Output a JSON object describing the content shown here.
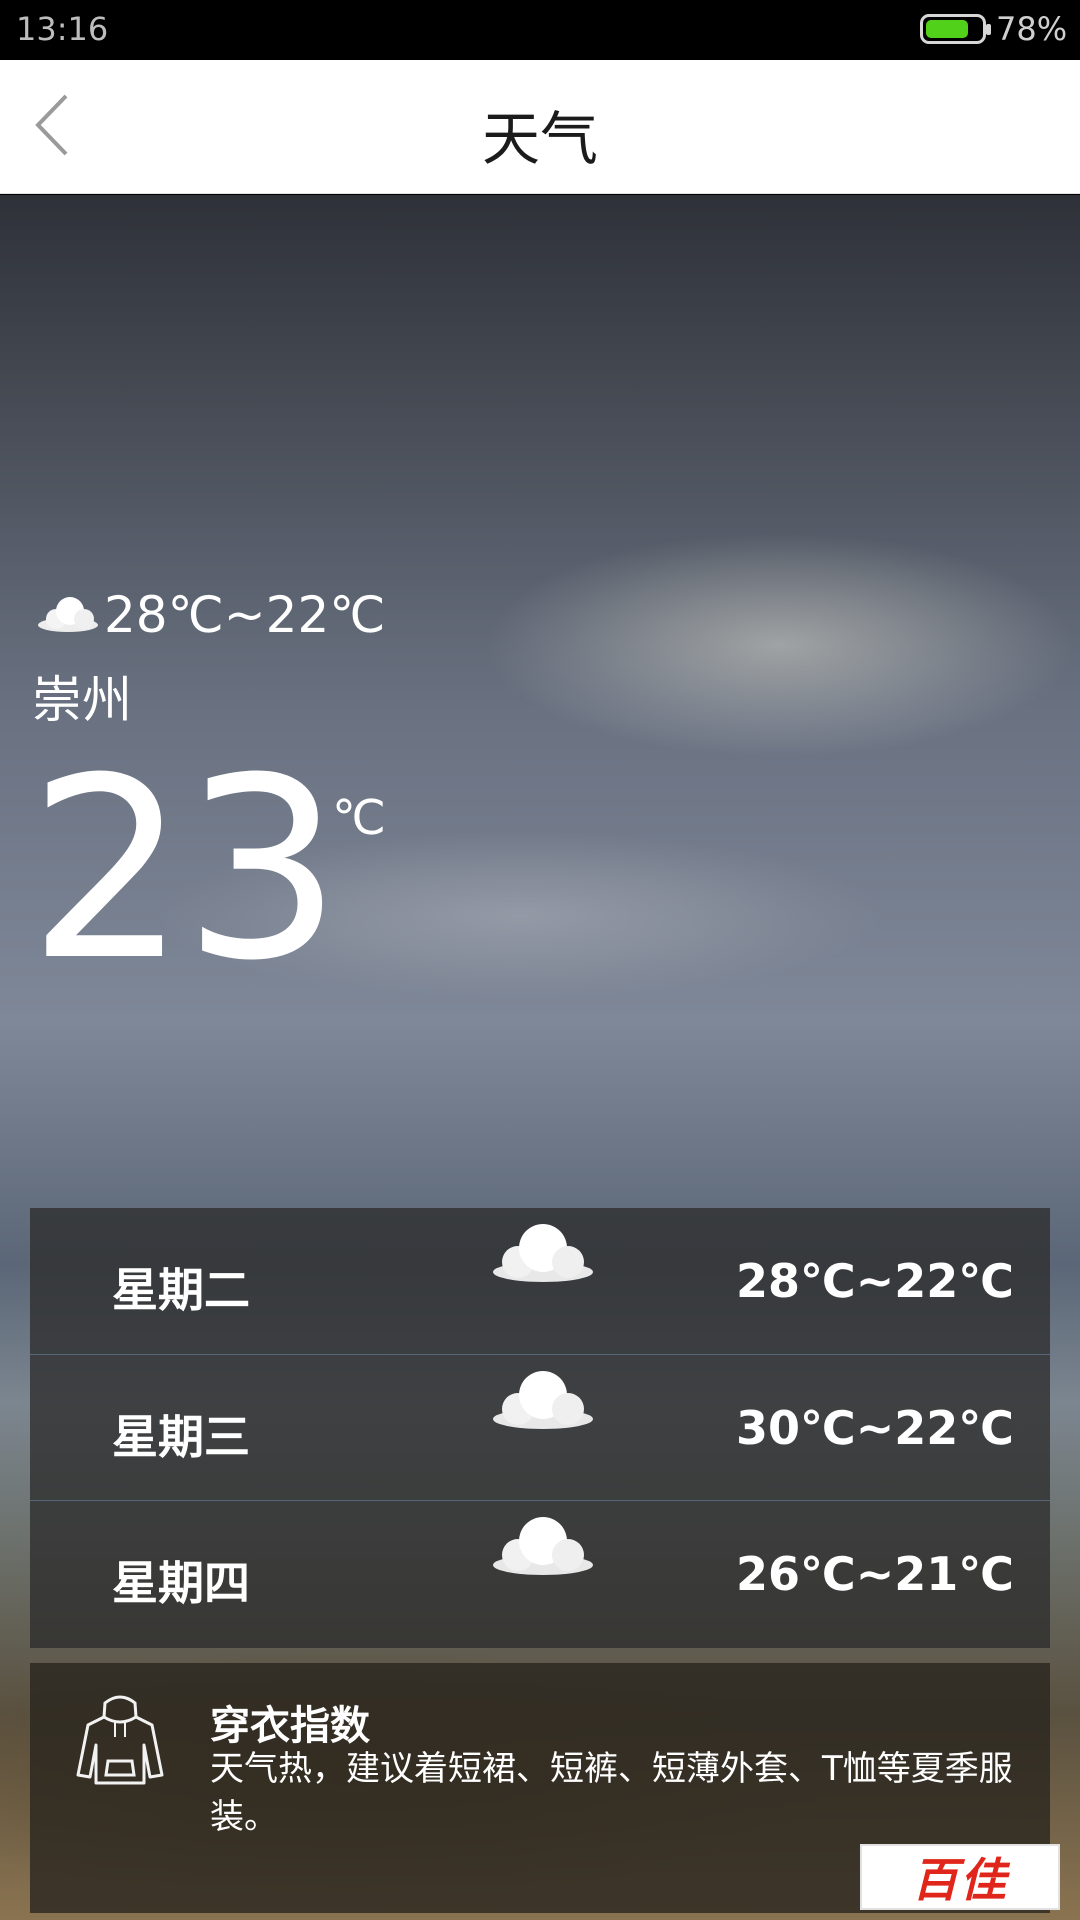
{
  "status_bar": {
    "time": "13:16",
    "battery_percent": "78%",
    "battery_level": 0.78
  },
  "header": {
    "title": "天气",
    "back_icon": "chevron-left-icon"
  },
  "today": {
    "icon": "cloud-icon",
    "range": "28℃~22℃",
    "city": "崇州",
    "current_temp": "23",
    "unit": "℃"
  },
  "forecast": [
    {
      "day": "星期二",
      "icon": "cloud-icon",
      "range": "28℃~22℃"
    },
    {
      "day": "星期三",
      "icon": "cloud-icon",
      "range": "30℃~22℃"
    },
    {
      "day": "星期四",
      "icon": "cloud-icon",
      "range": "26℃~21℃"
    }
  ],
  "clothing_index": {
    "icon": "hoodie-icon",
    "title": "穿衣指数",
    "text": "天气热，建议着短裙、短裤、短薄外套、T恤等夏季服装。"
  },
  "watermark": {
    "logo_text": "百佳"
  }
}
